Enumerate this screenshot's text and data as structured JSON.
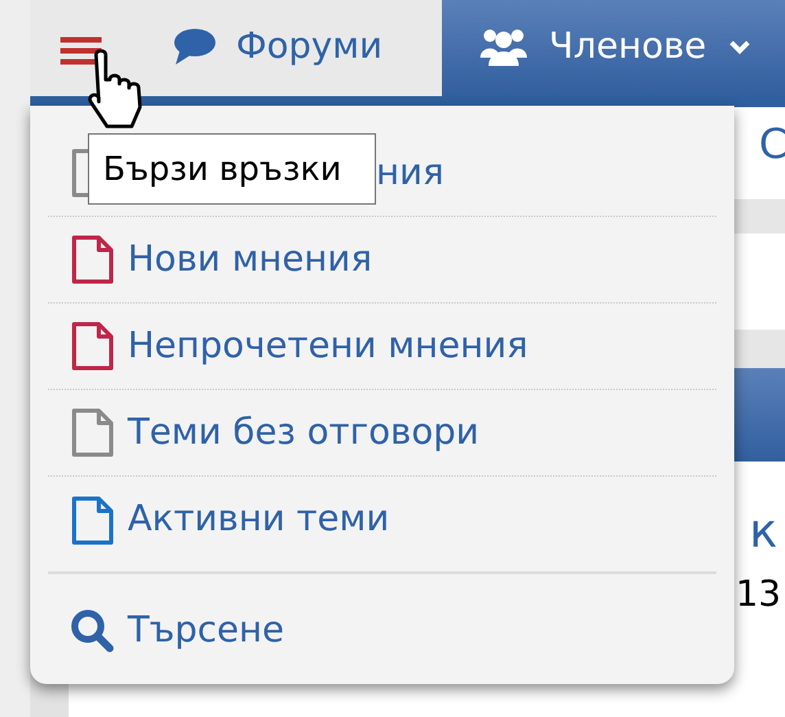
{
  "navbar": {
    "tabs": [
      {
        "kind": "menu",
        "selected": false
      },
      {
        "kind": "forums",
        "label": "Форуми",
        "selected": false
      },
      {
        "kind": "members",
        "label": "Членове",
        "selected": true
      }
    ]
  },
  "quick_links": {
    "tooltip": "Бързи връзки",
    "items": [
      {
        "kind": "page",
        "label": "ния",
        "color": "#8a8a8a"
      },
      {
        "kind": "page",
        "label": "Нови мнения",
        "color": "#c0254a"
      },
      {
        "kind": "page",
        "label": "Непрочетени мнения",
        "color": "#c0254a"
      },
      {
        "kind": "page",
        "label": "Теми без отговори",
        "color": "#8a8a8a"
      },
      {
        "kind": "page",
        "label": "Активни теми",
        "color": "#1a73c8"
      },
      {
        "kind": "search",
        "label": "Търсене"
      }
    ]
  },
  "background": {
    "heading_fragment": "С",
    "title_fragment": "к",
    "number_fragment": "13"
  }
}
